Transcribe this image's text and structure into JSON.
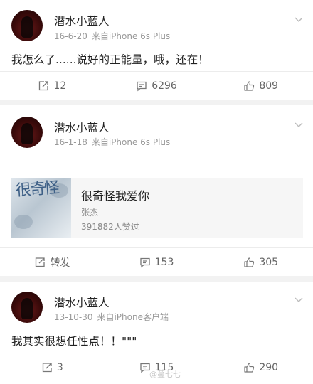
{
  "posts": [
    {
      "author": "潜水小蓝人",
      "date": "16-6-20",
      "source": "来自iPhone 6s Plus",
      "text": "我怎么了......说好的正能量，哦，还在！",
      "repost": "12",
      "comments": "6296",
      "likes": "809"
    },
    {
      "author": "潜水小蓝人",
      "date": "16-1-18",
      "source": "来自iPhone 6s Plus",
      "music_card": {
        "cover_text": "很奇怪",
        "title": "很奇怪我爱你",
        "artist": "张杰",
        "likes": "391882人赞过"
      },
      "repost": "转发",
      "comments": "153",
      "likes": "305"
    },
    {
      "author": "潜水小蓝人",
      "date": "13-10-30",
      "source": "来自iPhone客户端",
      "text": "我其实很想任性点！！\"\"\"",
      "repost": "3",
      "comments": "115",
      "likes": "290"
    }
  ],
  "watermark": "@蔓七七",
  "icons": [
    "chevron-down-icon",
    "repost-icon",
    "comment-icon",
    "like-icon"
  ],
  "colors": {
    "page_bg": "#f2f2f2",
    "card_bg": "#ffffff",
    "meta": "#999999"
  }
}
